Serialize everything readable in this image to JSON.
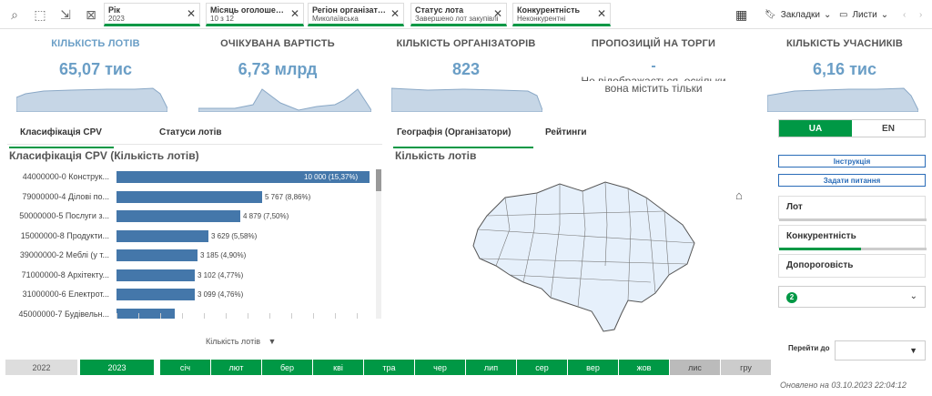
{
  "filters": [
    {
      "title": "Рік",
      "value": "2023"
    },
    {
      "title": "Місяць оголошення ...",
      "value": "10 з 12"
    },
    {
      "title": "Регіон організатора",
      "value": "Миколаївська"
    },
    {
      "title": "Статус лота",
      "value": "Завершено лот закупівлі"
    },
    {
      "title": "Конкурентність",
      "value": "Неконкурентні"
    }
  ],
  "toolbar": {
    "bookmarks": "Закладки",
    "sheets": "Листи"
  },
  "kpis": [
    {
      "label": "КІЛЬКІСТЬ ЛОТІВ",
      "value": "65,07 тис"
    },
    {
      "label": "ОЧІКУВАНА ВАРТІСТЬ",
      "value": "6,73 млрд"
    },
    {
      "label": "КІЛЬКІСТЬ ОРГАНІЗАТОРІВ",
      "value": "823"
    },
    {
      "label": "ПРОПОЗИЦІЙ НА ТОРГИ",
      "value": "-",
      "note1": "Не відображається, оскільки",
      "note2": "вона містить тільки"
    },
    {
      "label": "КІЛЬКІСТЬ УЧАСНИКІВ",
      "value": "6,16 тис"
    }
  ],
  "tabs_left": [
    "Класифікація CPV",
    "Статуси лотів"
  ],
  "tabs_right": [
    "Географія (Організатори)",
    "Рейтинги"
  ],
  "bar_title": "Класифікація CPV (Кількість лотів)",
  "map_title": "Кількість лотів",
  "chart_data": {
    "type": "bar",
    "title": "Класифікація CPV (Кількість лотів)",
    "xlabel": "Кількість лотів",
    "categories": [
      "44000000-0 Конструк...",
      "79000000-4 Ділові по...",
      "50000000-5 Послуги з...",
      "15000000-8 Продукти...",
      "39000000-2 Меблі (у т...",
      "71000000-8 Архітекту...",
      "31000000-6 Електрот...",
      "45000000-7 Будівельн..."
    ],
    "values": [
      10000,
      5767,
      4879,
      3629,
      3185,
      3102,
      3099,
      2300
    ],
    "labels": [
      "10 000 (15,37%)",
      "5 767 (8,86%)",
      "4 879 (7,50%)",
      "3 629 (5,58%)",
      "3 185 (4,90%)",
      "3 102 (4,77%)",
      "3 099 (4,76%)",
      ""
    ]
  },
  "lang": {
    "ua": "UA",
    "en": "EN"
  },
  "buttons": {
    "instruction": "Інструкція",
    "ask": "Задати питання"
  },
  "nav": [
    "Лот",
    "Конкурентність",
    "Допороговість"
  ],
  "dropdown_badge": "2",
  "goto_label": "Перейти до",
  "years": [
    "2022",
    "2023"
  ],
  "months": [
    "січ",
    "лют",
    "бер",
    "кві",
    "тра",
    "чер",
    "лип",
    "сер",
    "вер",
    "жов",
    "лис",
    "гру"
  ],
  "updated": "Оновлено на 03.10.2023 22:04:12"
}
